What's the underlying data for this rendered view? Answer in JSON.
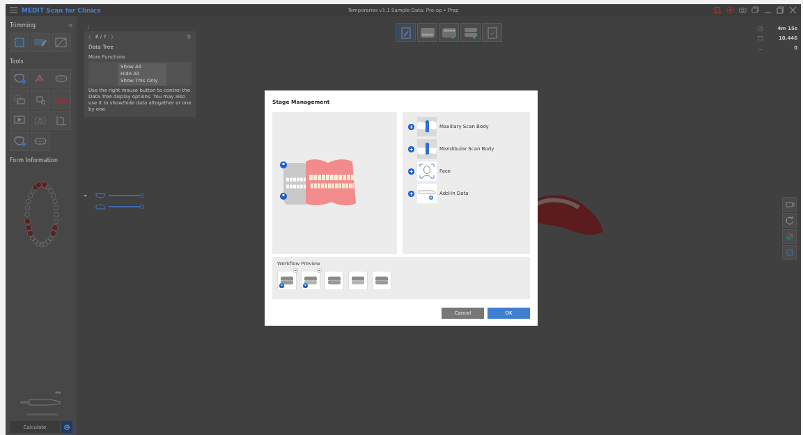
{
  "app_title": "MEDIT Scan for Clinics",
  "window_title": "Temporaries v1.1 Sample Data: Pre-op • Prep",
  "window_controls": [
    {
      "kind": "screen-record"
    },
    {
      "kind": "record"
    },
    {
      "kind": "camera"
    },
    {
      "kind": "windows"
    },
    {
      "kind": "minimize"
    },
    {
      "kind": "maximize"
    },
    {
      "kind": "close"
    }
  ],
  "sidebar": {
    "trimming": {
      "title": "Trimming",
      "tools": [
        {
          "kind": "crop"
        },
        {
          "kind": "brush"
        },
        {
          "kind": "curve"
        }
      ]
    },
    "tools": {
      "title": "Tools",
      "tools": [
        {
          "kind": "tooth-lock"
        },
        {
          "kind": "color"
        },
        {
          "kind": "arch"
        },
        {
          "kind": "overlay"
        },
        {
          "kind": "tooth-search"
        },
        {
          "kind": "gum"
        },
        {
          "kind": "play"
        },
        {
          "kind": "camera"
        },
        {
          "kind": "measure"
        },
        {
          "kind": "tooth-lock"
        },
        {
          "kind": "arch"
        }
      ]
    },
    "form_title": "Form Information",
    "calculate_label": "Calculate"
  },
  "tip_card": {
    "pager": "6 / 7",
    "title": "Data Tree",
    "subtitle": "More Functions",
    "menu": [
      "Show All",
      "Hide All",
      "Show This Only"
    ],
    "description": "Use the right mouse button to control the Data Tree display options. You may also use it to show/hide data altogether or one by one."
  },
  "stages": [
    {
      "kind": "edit",
      "selected": true,
      "done": false
    },
    {
      "kind": "upper",
      "selected": false,
      "done": false
    },
    {
      "kind": "lower",
      "selected": false,
      "done": true
    },
    {
      "kind": "occlusion",
      "selected": false,
      "done": true
    },
    {
      "kind": "review",
      "selected": false,
      "done": false
    }
  ],
  "stats": [
    {
      "kind": "time",
      "value": "4m 15s"
    },
    {
      "kind": "count",
      "value": "10,446"
    },
    {
      "kind": "other",
      "value": "0"
    }
  ],
  "data_tree": [
    {
      "kind": "upper",
      "level": 1.0
    },
    {
      "kind": "lower",
      "level": 1.0
    }
  ],
  "view_tools": [
    {
      "kind": "camera"
    },
    {
      "kind": "rotate"
    },
    {
      "kind": "color"
    },
    {
      "kind": "square"
    }
  ],
  "dialog": {
    "title": "Stage Management",
    "options": [
      {
        "kind": "maxillary",
        "label": "Maxillary Scan Body"
      },
      {
        "kind": "mandibular",
        "label": "Mandibular Scan Body"
      },
      {
        "kind": "face",
        "label": "Face"
      },
      {
        "kind": "addin",
        "label": "Add-In Data"
      }
    ],
    "workflow_title": "Workflow Preview",
    "workflow": [
      {
        "removable": true,
        "flagged": true
      },
      {
        "removable": true,
        "flagged": true
      },
      {
        "removable": false,
        "flagged": false
      },
      {
        "removable": false,
        "flagged": false
      },
      {
        "removable": false,
        "flagged": false
      }
    ],
    "buttons": [
      {
        "kind": "secondary",
        "label": "Cancel"
      },
      {
        "kind": "primary",
        "label": "OK"
      }
    ]
  }
}
